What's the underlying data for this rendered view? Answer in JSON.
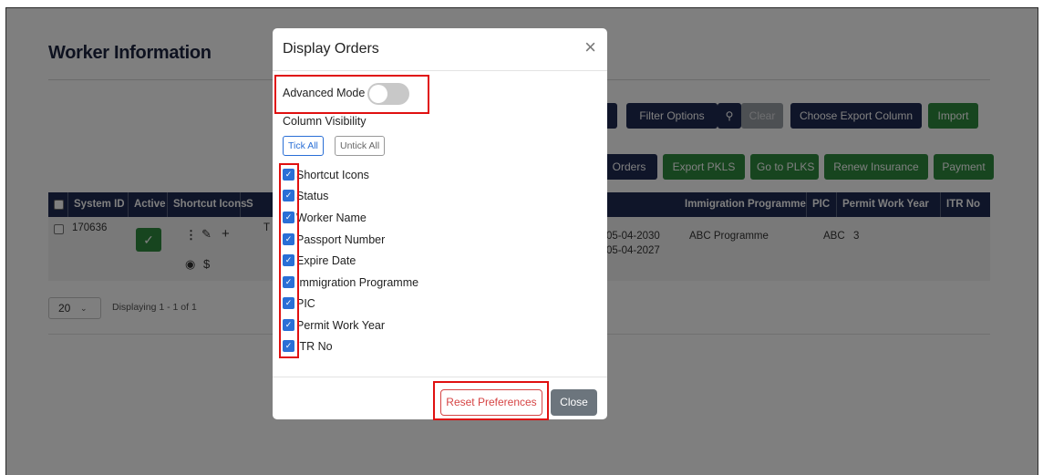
{
  "page": {
    "title": "Worker Information",
    "toolbar1": {
      "search_icon": "search-icon",
      "filter_options": "Filter Options",
      "clear": "Clear",
      "choose_export_column": "Choose Export Column",
      "import": "Import"
    },
    "toolbar2": {
      "display_orders": "Orders",
      "export_pkls": "Export PKLS",
      "go_to_plks": "Go to PLKS",
      "renew_insurance": "Renew Insurance",
      "payment": "Payment"
    },
    "table": {
      "headers": [
        "System ID",
        "Active",
        "Shortcut Icons",
        "S",
        "Immigration Programme",
        "PIC",
        "Permit Work Year",
        "ITR No"
      ],
      "row": {
        "system_id": "170636",
        "name_initial": "T",
        "date1": "05-04-2030",
        "date2": "05-04-2027",
        "immigration_programme": "ABC Programme",
        "pic": "ABC",
        "permit_work_year": "3"
      }
    },
    "pager": {
      "page_size": "20",
      "displaying": "Displaying 1 - 1 of 1"
    }
  },
  "modal": {
    "title": "Display Orders",
    "advanced_mode_label": "Advanced Mode",
    "advanced_mode_on": false,
    "column_visibility_label": "Column Visibility",
    "tick_all": "Tick All",
    "untick_all": "Untick All",
    "columns": [
      {
        "label": "Shortcut Icons",
        "checked": true
      },
      {
        "label": "Status",
        "checked": true
      },
      {
        "label": "Worker Name",
        "checked": true
      },
      {
        "label": "Passport Number",
        "checked": true
      },
      {
        "label": "Expire Date",
        "checked": true
      },
      {
        "label": "Immigration Programme",
        "checked": true
      },
      {
        "label": "PIC",
        "checked": true
      },
      {
        "label": "Permit Work Year",
        "checked": true
      },
      {
        "label": "ITR No",
        "checked": true
      }
    ],
    "reset_preferences": "Reset Preferences",
    "close": "Close"
  },
  "colors": {
    "navy": "#1f2a52",
    "green": "#2f8a3f",
    "checkbox_blue": "#2a6fd6",
    "highlight_red": "#e01010"
  }
}
